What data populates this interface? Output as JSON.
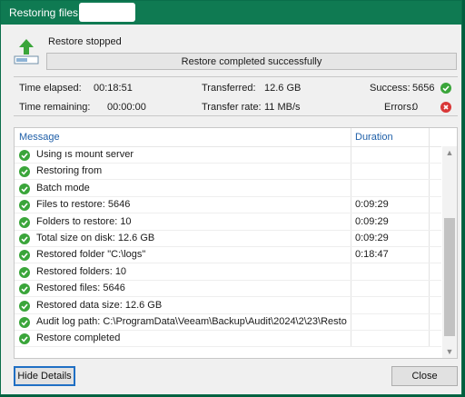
{
  "window": {
    "title": "Restoring files t"
  },
  "status": {
    "text": "Restore stopped",
    "progress_text": "Restore completed successfully"
  },
  "stats": {
    "time_elapsed_label": "Time elapsed:",
    "time_elapsed": "00:18:51",
    "time_remaining_label": "Time remaining:",
    "time_remaining": "00:00:00",
    "transferred_label": "Transferred:",
    "transferred": "12.6 GB",
    "transfer_rate_label": "Transfer rate:",
    "transfer_rate": "11 MB/s",
    "success_label": "Success:",
    "success": "5656",
    "errors_label": "Errors:",
    "errors": "0"
  },
  "log": {
    "col_message": "Message",
    "col_duration": "Duration",
    "rows": [
      {
        "message": "Using                 ıs mount server",
        "duration": ""
      },
      {
        "message": "Restoring from",
        "duration": ""
      },
      {
        "message": "Batch mode",
        "duration": ""
      },
      {
        "message": "Files to restore: 5646",
        "duration": "0:09:29"
      },
      {
        "message": "Folders to restore: 10",
        "duration": "0:09:29"
      },
      {
        "message": "Total size on disk: 12.6 GB",
        "duration": "0:09:29"
      },
      {
        "message": "Restored folder \"C:\\logs\"",
        "duration": "0:18:47"
      },
      {
        "message": "Restored folders: 10",
        "duration": ""
      },
      {
        "message": "Restored files: 5646",
        "duration": ""
      },
      {
        "message": "Restored data size: 12.6 GB",
        "duration": ""
      },
      {
        "message": "Audit log path: C:\\ProgramData\\Veeam\\Backup\\Audit\\2024\\2\\23\\Resto...",
        "duration": ""
      },
      {
        "message": "Restore completed",
        "duration": ""
      }
    ]
  },
  "buttons": {
    "hide_details": "Hide Details",
    "close": "Close"
  },
  "colors": {
    "accent": "#0f7a52",
    "ok": "#3aa53a",
    "error": "#d93838",
    "link": "#1f5fa8"
  },
  "icons": {
    "status": "restore-up-arrow-icon",
    "row": "success-check-icon",
    "error": "error-x-icon"
  }
}
